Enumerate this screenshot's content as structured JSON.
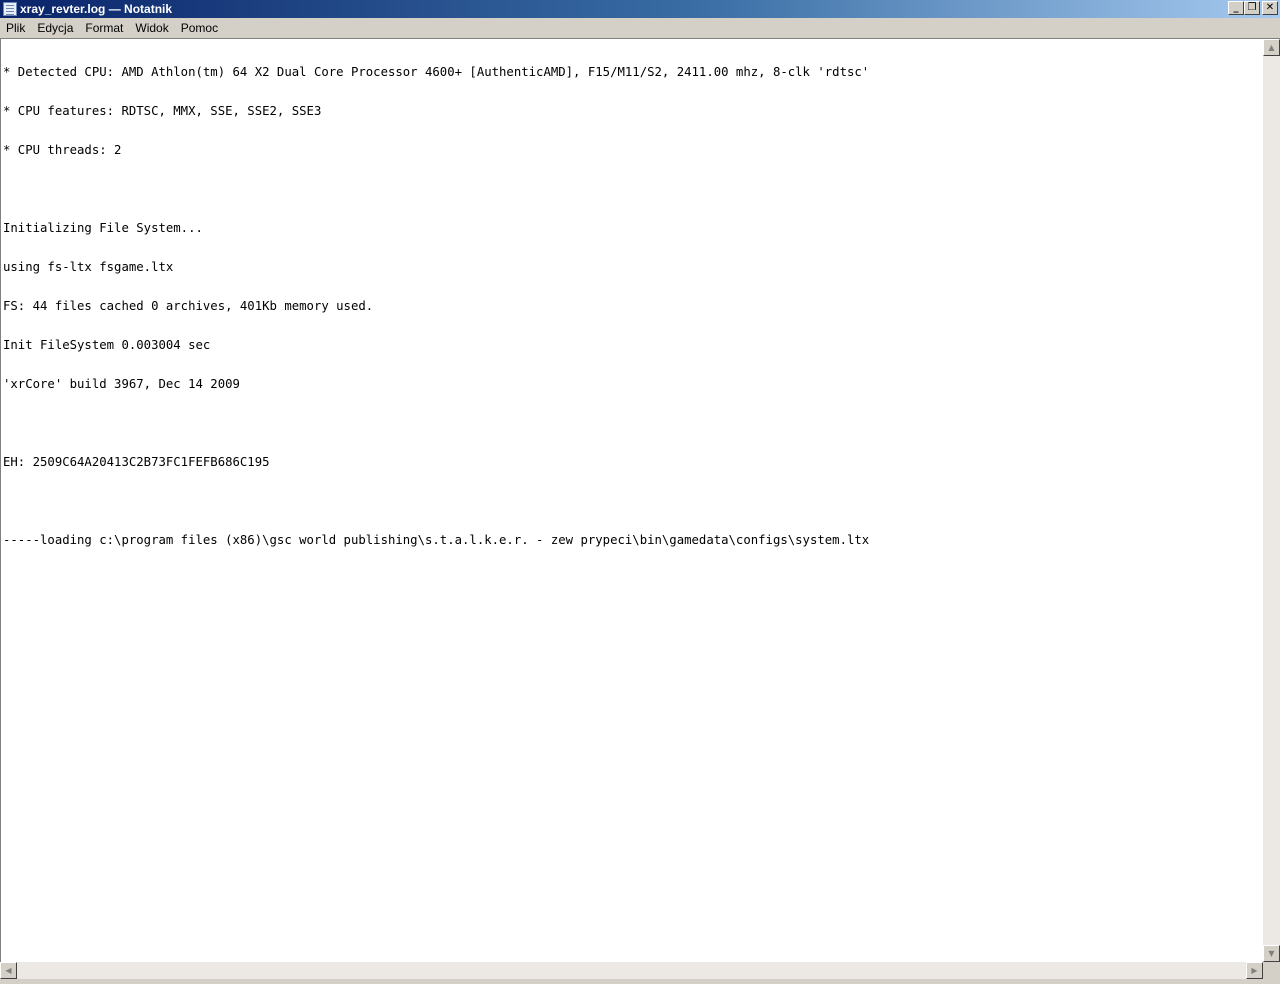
{
  "window": {
    "title": "xray_revter.log — Notatnik",
    "icon": "notepad-icon"
  },
  "title_buttons": {
    "minimize": "_",
    "maximize": "❐",
    "close": "✕"
  },
  "menu": {
    "items": [
      {
        "label": "Plik"
      },
      {
        "label": "Edycja"
      },
      {
        "label": "Format"
      },
      {
        "label": "Widok"
      },
      {
        "label": "Pomoc"
      }
    ]
  },
  "document": {
    "lines": [
      "* Detected CPU: AMD Athlon(tm) 64 X2 Dual Core Processor 4600+ [AuthenticAMD], F15/M11/S2, 2411.00 mhz, 8-clk 'rdtsc'",
      "* CPU features: RDTSC, MMX, SSE, SSE2, SSE3",
      "* CPU threads: 2",
      "",
      "Initializing File System...",
      "using fs-ltx fsgame.ltx",
      "FS: 44 files cached 0 archives, 401Kb memory used.",
      "Init FileSystem 0.003004 sec",
      "'xrCore' build 3967, Dec 14 2009",
      "",
      "EH: 2509C64A20413C2B73FC1FEFB686C195",
      "",
      "-----loading c:\\program files (x86)\\gsc world publishing\\s.t.a.l.k.e.r. - zew prypeci\\bin\\gamedata\\configs\\system.ltx"
    ]
  },
  "scrollbars": {
    "up_arrow": "▲",
    "down_arrow": "▼",
    "left_arrow": "◀",
    "right_arrow": "▶"
  }
}
